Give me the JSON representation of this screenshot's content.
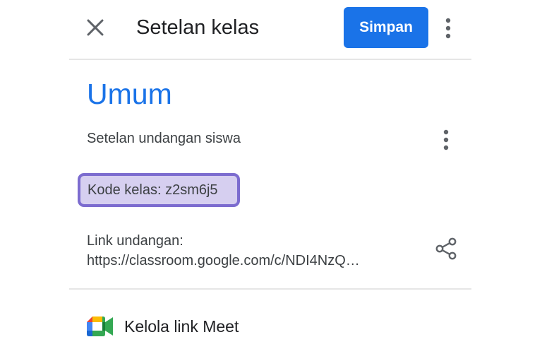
{
  "header": {
    "close_icon": "close-icon",
    "title": "Setelan kelas",
    "save_label": "Simpan",
    "more_icon": "more-vert-icon"
  },
  "section": {
    "title": "Umum"
  },
  "invite_settings": {
    "label": "Setelan undangan siswa",
    "more_icon": "more-vert-icon"
  },
  "class_code": {
    "label": "Kode kelas: z2sm6j5",
    "highlight_fill": "#d6cff0",
    "highlight_border": "#7c6ccf"
  },
  "invite_link": {
    "label": "Link undangan:",
    "url": "https://classroom.google.com/c/NDI4NzQ…",
    "share_icon": "share-icon"
  },
  "meet": {
    "label": "Kelola link Meet",
    "icon": "google-meet-icon"
  },
  "colors": {
    "accent": "#1a73e8",
    "text_primary": "#202124",
    "text_secondary": "#3c4043",
    "icon": "#5f6368",
    "divider": "#e6e6e6"
  }
}
